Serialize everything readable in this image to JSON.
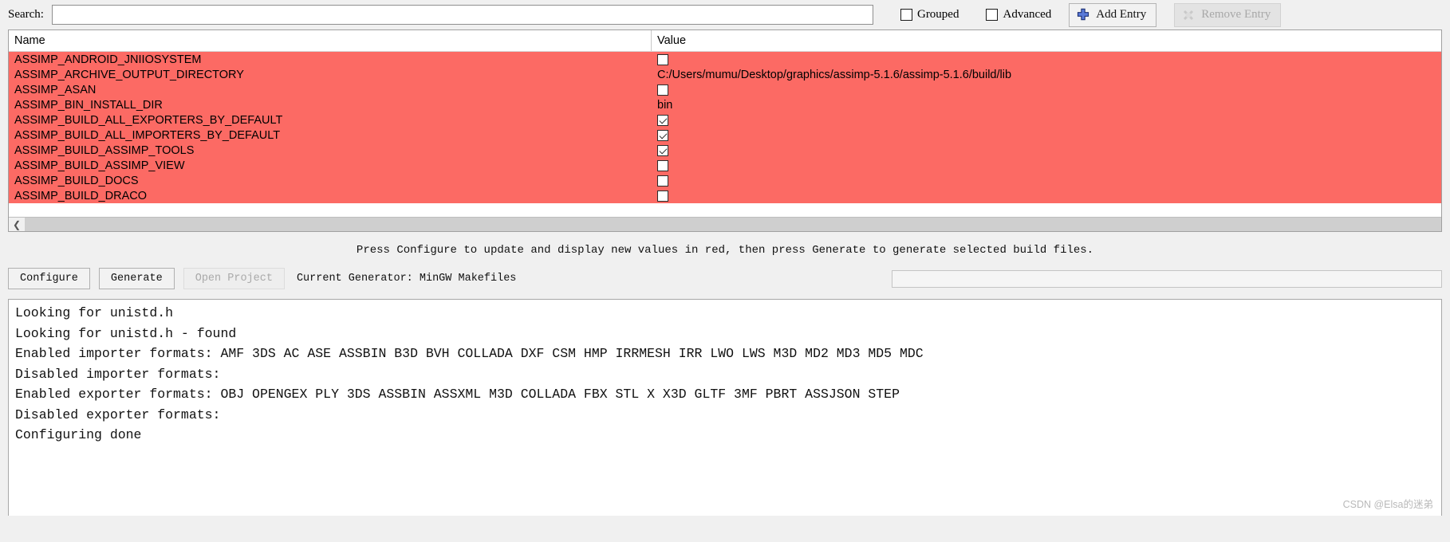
{
  "toolbar": {
    "search_label": "Search:",
    "search_value": "",
    "search_placeholder": "",
    "grouped_label": "Grouped",
    "grouped_checked": false,
    "advanced_label": "Advanced",
    "advanced_checked": false,
    "add_entry_label": "Add Entry",
    "add_entry_icon": "plus-icon",
    "remove_entry_label": "Remove Entry",
    "remove_entry_icon": "remove-icon",
    "remove_entry_disabled": true
  },
  "table": {
    "columns": [
      "Name",
      "Value"
    ],
    "row_highlight_color": "#fc6a64",
    "rows": [
      {
        "name": "ASSIMP_ANDROID_JNIIOSYSTEM",
        "type": "bool",
        "value": "",
        "checked": false
      },
      {
        "name": "ASSIMP_ARCHIVE_OUTPUT_DIRECTORY",
        "type": "string",
        "value": "C:/Users/mumu/Desktop/graphics/assimp-5.1.6/assimp-5.1.6/build/lib",
        "checked": false
      },
      {
        "name": "ASSIMP_ASAN",
        "type": "bool",
        "value": "",
        "checked": false
      },
      {
        "name": "ASSIMP_BIN_INSTALL_DIR",
        "type": "string",
        "value": "bin",
        "checked": false
      },
      {
        "name": "ASSIMP_BUILD_ALL_EXPORTERS_BY_DEFAULT",
        "type": "bool",
        "value": "",
        "checked": true
      },
      {
        "name": "ASSIMP_BUILD_ALL_IMPORTERS_BY_DEFAULT",
        "type": "bool",
        "value": "",
        "checked": true
      },
      {
        "name": "ASSIMP_BUILD_ASSIMP_TOOLS",
        "type": "bool",
        "value": "",
        "checked": true
      },
      {
        "name": "ASSIMP_BUILD_ASSIMP_VIEW",
        "type": "bool",
        "value": "",
        "checked": false
      },
      {
        "name": "ASSIMP_BUILD_DOCS",
        "type": "bool",
        "value": "",
        "checked": false
      },
      {
        "name": "ASSIMP_BUILD_DRACO",
        "type": "bool",
        "value": "",
        "checked": false
      }
    ],
    "scroll_left_icon": "chevron-left-icon"
  },
  "hint": "Press Configure to update and display new values in red, then press Generate to generate selected build files.",
  "actions": {
    "configure_label": "Configure",
    "generate_label": "Generate",
    "open_project_label": "Open Project",
    "open_project_disabled": true,
    "current_generator_text": "Current Generator: MinGW Makefiles"
  },
  "console": {
    "lines": [
      "Looking for unistd.h",
      "Looking for unistd.h - found",
      "Enabled importer formats: AMF 3DS AC ASE ASSBIN B3D BVH COLLADA DXF CSM HMP IRRMESH IRR LWO LWS M3D MD2 MD3 MD5 MDC",
      "Disabled importer formats:",
      "Enabled exporter formats: OBJ OPENGEX PLY 3DS ASSBIN ASSXML M3D COLLADA FBX STL X X3D GLTF 3MF PBRT ASSJSON STEP",
      "Disabled exporter formats:",
      "Configuring done"
    ]
  },
  "watermark": "CSDN @Elsa的迷弟"
}
